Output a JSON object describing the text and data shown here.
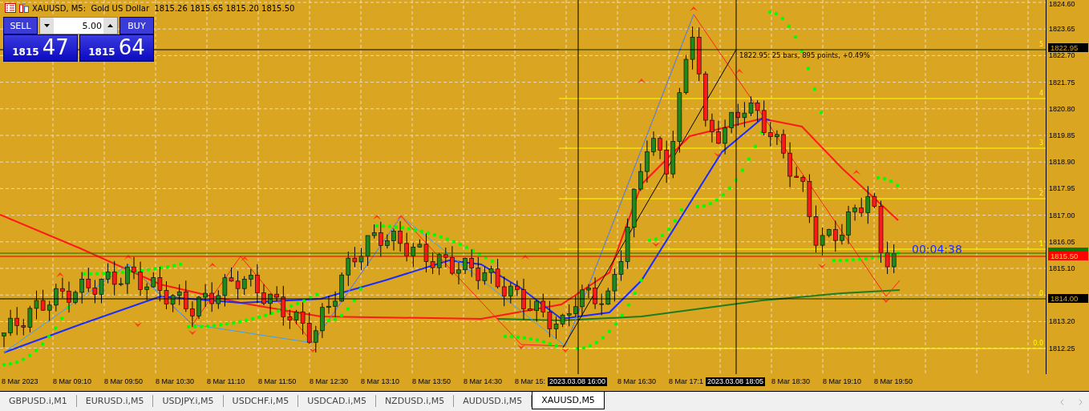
{
  "chart_header": {
    "title": "XAUUSD, M5:  Gold US Dollar  1815.26 1815.65 1815.20 1815.50"
  },
  "one_click_trading": {
    "sell_label": "SELL",
    "buy_label": "BUY",
    "volume": "5.00",
    "sell_price_big": "1815",
    "sell_price_small": "47",
    "buy_price_big": "1815",
    "buy_price_small": "64"
  },
  "measurement": "1822.95: 25 bars, 895 points, +0.49%",
  "timer": "00:04:38",
  "fibo_levels": [
    "5",
    "4",
    "3",
    "2",
    "1",
    "0",
    "0.0"
  ],
  "price_axis": [
    "1824.60",
    "1823.65",
    "1822.70",
    "1821.75",
    "1820.80",
    "1819.85",
    "1818.90",
    "1817.95",
    "1817.00",
    "1816.05",
    "1815.10",
    "1813.20",
    "1812.25"
  ],
  "price_tags": [
    {
      "text": "1822.95",
      "kind": "crosshair"
    },
    {
      "text": "1815.50",
      "kind": "bid"
    },
    {
      "text": "1814.00",
      "kind": "crosshair"
    }
  ],
  "time_axis": [
    "8 Mar 2023",
    "8 Mar 09:10",
    "8 Mar 09:50",
    "8 Mar 10:30",
    "8 Mar 11:10",
    "8 Mar 11:50",
    "8 Mar 12:30",
    "8 Mar 13:10",
    "8 Mar 13:50",
    "8 Mar 14:30",
    "8 Mar 15:",
    "8 Mar 16:30",
    "8 Mar 17:1",
    "8 Mar 18:30",
    "8 Mar 19:10",
    "8 Mar 19:50"
  ],
  "time_tags": [
    "2023.03.08 16:00",
    "2023.03.08 18:05"
  ],
  "tabs": [
    {
      "label": "GBPUSD.i,M1",
      "selected": false
    },
    {
      "label": "EURUSD.i,M5",
      "selected": false
    },
    {
      "label": "USDJPY.i,M5",
      "selected": false
    },
    {
      "label": "USDCHF.i,M5",
      "selected": false
    },
    {
      "label": "USDCAD.i,M5",
      "selected": false
    },
    {
      "label": "NZDUSD.i,M5",
      "selected": false
    },
    {
      "label": "AUDUSD.i,M5",
      "selected": false
    },
    {
      "label": "XAUUSD,M5",
      "selected": true
    }
  ]
}
